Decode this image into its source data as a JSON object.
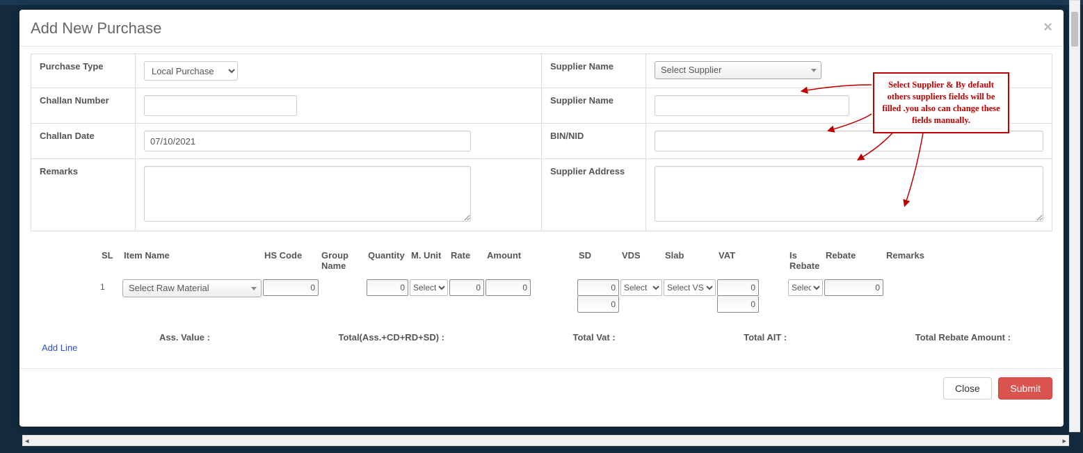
{
  "modal": {
    "title": "Add New Purchase",
    "close_symbol": "×"
  },
  "form": {
    "purchase_type": {
      "label": "Purchase Type",
      "value": "Local Purchase"
    },
    "supplier_select": {
      "label": "Supplier Name",
      "placeholder": "Select Supplier"
    },
    "challan_number": {
      "label": "Challan Number",
      "value": ""
    },
    "supplier_name_text": {
      "label": "Supplier Name",
      "value": ""
    },
    "challan_date": {
      "label": "Challan Date",
      "value": "07/10/2021"
    },
    "bin_nid": {
      "label": "BIN/NID",
      "value": ""
    },
    "remarks": {
      "label": "Remarks",
      "value": ""
    },
    "supplier_address": {
      "label": "Supplier Address",
      "value": ""
    }
  },
  "annotation": {
    "text": "Select Supplier & By default others suppliers fields will be filled .you also can change these fields manually."
  },
  "line_headers": {
    "sl": "SL",
    "item": "Item Name",
    "hs": "HS Code",
    "group": "Group Name",
    "qty": "Quantity",
    "unit": "M. Unit",
    "rate": "Rate",
    "amount": "Amount",
    "sd": "SD",
    "vds": "VDS",
    "slab": "Slab",
    "vat": "VAT",
    "isrebate": "Is Rebate",
    "rebate": "Rebate",
    "remarks": "Remarks"
  },
  "lines": [
    {
      "sl": "1",
      "item_placeholder": "Select Raw Material",
      "hs": "0",
      "qty": "0",
      "unit": "Select",
      "rate": "0",
      "amount": "0",
      "sd1": "0",
      "sd2": "0",
      "vds": "Select",
      "slab": "Select VSl",
      "vat1": "0",
      "vat2": "0",
      "isrebate": "Select",
      "rebate": "0"
    }
  ],
  "totals": {
    "ass": "Ass. Value :",
    "total_asd": "Total(Ass.+CD+RD+SD) :",
    "total_vat": "Total Vat :",
    "total_ait": "Total AIT :",
    "total_rebate": "Total Rebate Amount :"
  },
  "actions": {
    "add_line": "Add Line",
    "close": "Close",
    "submit": "Submit"
  },
  "scroll": {
    "left": "◂",
    "right": "▸"
  }
}
